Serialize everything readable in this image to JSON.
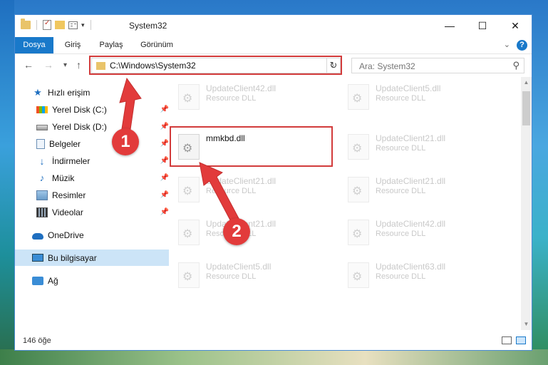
{
  "window": {
    "title": "System32",
    "minimize_icon": "minimize-icon",
    "maximize_icon": "maximize-icon",
    "close_icon": "close-icon"
  },
  "ribbon": {
    "tabs": [
      "Dosya",
      "Giriş",
      "Paylaş",
      "Görünüm"
    ],
    "active_tab_color": "#1979ca"
  },
  "navigation": {
    "address": "C:\\Windows\\System32",
    "search_placeholder": "Ara: System32"
  },
  "sidebar": {
    "quick_access": "Hızlı erişim",
    "items": [
      {
        "label": "Yerel Disk (C:)",
        "icon": "drive-c-icon"
      },
      {
        "label": "Yerel Disk (D:)",
        "icon": "drive-d-icon"
      },
      {
        "label": "Belgeler",
        "icon": "documents-icon"
      },
      {
        "label": "İndirmeler",
        "icon": "downloads-icon"
      },
      {
        "label": "Müzik",
        "icon": "music-icon"
      },
      {
        "label": "Resimler",
        "icon": "pictures-icon"
      },
      {
        "label": "Videolar",
        "icon": "videos-icon"
      }
    ],
    "onedrive": "OneDrive",
    "this_pc": "Bu bilgisayar",
    "network": "Ağ"
  },
  "files": [
    {
      "name": "UpdateClient42.dll",
      "desc": "Resource DLL"
    },
    {
      "name": "UpdateClient5.dll",
      "desc": "Resource DLL"
    },
    {
      "name": "mmkbd.dll",
      "desc": ""
    },
    {
      "name": "UpdateClient21.dll",
      "desc": "Resource DLL"
    },
    {
      "name": "UpdateClient21.dll",
      "desc": "Resource DLL"
    },
    {
      "name": "UpdateClient21.dll",
      "desc": "Resource DLL"
    },
    {
      "name": "UpdateClient21.dll",
      "desc": "Resource DLL"
    },
    {
      "name": "UpdateClient42.dll",
      "desc": "Resource DLL"
    },
    {
      "name": "UpdateClient5.dll",
      "desc": "Resource DLL"
    },
    {
      "name": "UpdateClient63.dll",
      "desc": "Resource DLL"
    }
  ],
  "status": {
    "item_count": "146 öğe"
  },
  "annotations": {
    "step1": "1",
    "step2": "2",
    "highlight_color": "#d23b3b"
  }
}
